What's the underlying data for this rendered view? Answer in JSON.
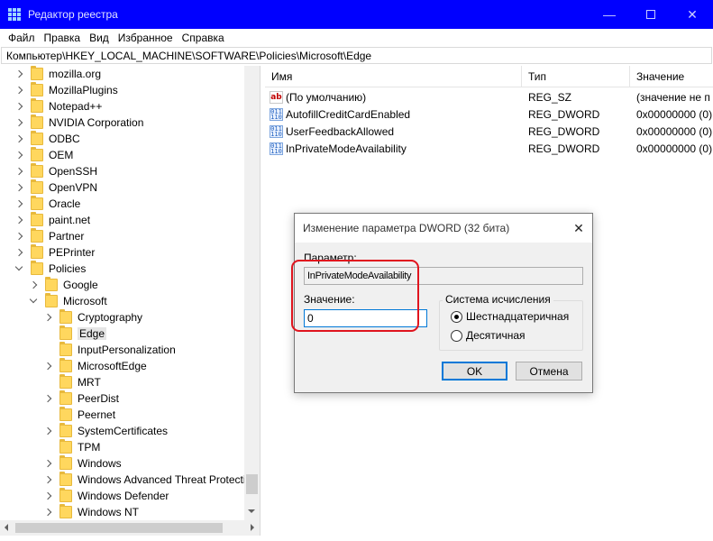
{
  "window": {
    "title": "Редактор реестра",
    "minimize_glyph": "—",
    "close_glyph": "✕"
  },
  "menu": [
    "Файл",
    "Правка",
    "Вид",
    "Избранное",
    "Справка"
  ],
  "address": "Компьютер\\HKEY_LOCAL_MACHINE\\SOFTWARE\\Policies\\Microsoft\\Edge",
  "tree": [
    {
      "label": "mozilla.org",
      "level": 1,
      "expander": "right"
    },
    {
      "label": "MozillaPlugins",
      "level": 1,
      "expander": "right"
    },
    {
      "label": "Notepad++",
      "level": 1,
      "expander": "right"
    },
    {
      "label": "NVIDIA Corporation",
      "level": 1,
      "expander": "right"
    },
    {
      "label": "ODBC",
      "level": 1,
      "expander": "right"
    },
    {
      "label": "OEM",
      "level": 1,
      "expander": "right"
    },
    {
      "label": "OpenSSH",
      "level": 1,
      "expander": "right"
    },
    {
      "label": "OpenVPN",
      "level": 1,
      "expander": "right"
    },
    {
      "label": "Oracle",
      "level": 1,
      "expander": "right"
    },
    {
      "label": "paint.net",
      "level": 1,
      "expander": "right"
    },
    {
      "label": "Partner",
      "level": 1,
      "expander": "right"
    },
    {
      "label": "PEPrinter",
      "level": 1,
      "expander": "right"
    },
    {
      "label": "Policies",
      "level": 1,
      "expander": "down"
    },
    {
      "label": "Google",
      "level": 2,
      "expander": "right"
    },
    {
      "label": "Microsoft",
      "level": 2,
      "expander": "down"
    },
    {
      "label": "Cryptography",
      "level": 3,
      "expander": "right"
    },
    {
      "label": "Edge",
      "level": 3,
      "expander": "none",
      "selected": true
    },
    {
      "label": "InputPersonalization",
      "level": 3,
      "expander": "none"
    },
    {
      "label": "MicrosoftEdge",
      "level": 3,
      "expander": "right"
    },
    {
      "label": "MRT",
      "level": 3,
      "expander": "none"
    },
    {
      "label": "PeerDist",
      "level": 3,
      "expander": "right"
    },
    {
      "label": "Peernet",
      "level": 3,
      "expander": "none"
    },
    {
      "label": "SystemCertificates",
      "level": 3,
      "expander": "right"
    },
    {
      "label": "TPM",
      "level": 3,
      "expander": "none"
    },
    {
      "label": "Windows",
      "level": 3,
      "expander": "right"
    },
    {
      "label": "Windows Advanced Threat Protection",
      "level": 3,
      "expander": "right"
    },
    {
      "label": "Windows Defender",
      "level": 3,
      "expander": "right"
    },
    {
      "label": "Windows NT",
      "level": 3,
      "expander": "right"
    }
  ],
  "list": {
    "columns": [
      "Имя",
      "Тип",
      "Значение"
    ],
    "rows": [
      {
        "icon": "string-value-icon",
        "icon_text": "ab",
        "name": "(По умолчанию)",
        "type": "REG_SZ",
        "value": "(значение не п"
      },
      {
        "icon": "dword-value-icon",
        "icon_text": "011\n110",
        "name": "AutofillCreditCardEnabled",
        "type": "REG_DWORD",
        "value": "0x00000000 (0)"
      },
      {
        "icon": "dword-value-icon",
        "icon_text": "011\n110",
        "name": "UserFeedbackAllowed",
        "type": "REG_DWORD",
        "value": "0x00000000 (0)"
      },
      {
        "icon": "dword-value-icon",
        "icon_text": "011\n110",
        "name": "InPrivateModeAvailability",
        "type": "REG_DWORD",
        "value": "0x00000000 (0)"
      }
    ]
  },
  "dialog": {
    "title": "Изменение параметра DWORD (32 бита)",
    "close_glyph": "✕",
    "param_label": "Параметр:",
    "param_value": "InPrivateModeAvailability",
    "value_label": "Значение:",
    "value_input": "0",
    "base_group_title": "Система исчисления",
    "radio_hex": "Шестнадцатеричная",
    "radio_dec": "Десятичная",
    "selected_base": "hex",
    "ok_label": "OK",
    "cancel_label": "Отмена"
  },
  "colors": {
    "titlebar": "#0000ff",
    "highlight": "#e0141e",
    "folder": "#ffd75e"
  }
}
